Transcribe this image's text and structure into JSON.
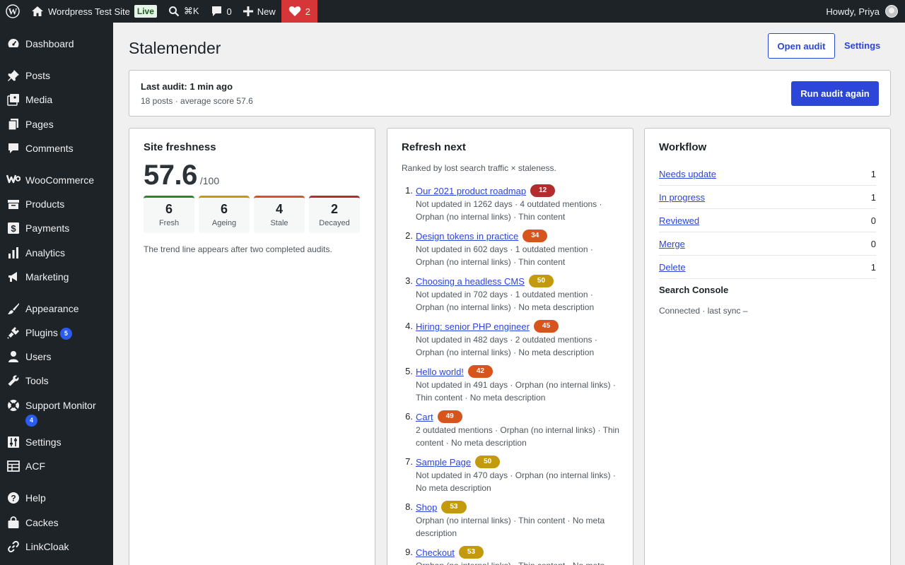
{
  "adminbar": {
    "site_name": "Wordpress Test Site",
    "live_badge": "Live",
    "search_shortcut": "⌘K",
    "comments_count": "0",
    "new_label": "New",
    "heart_count": "2",
    "greeting": "Howdy, Priya"
  },
  "sidebar": {
    "items": [
      {
        "label": "Dashboard",
        "icon": "dashboard-icon"
      },
      {
        "label": "Posts",
        "icon": "pin-icon"
      },
      {
        "label": "Media",
        "icon": "media-icon"
      },
      {
        "label": "Pages",
        "icon": "pages-icon"
      },
      {
        "label": "Comments",
        "icon": "comment-icon"
      },
      {
        "label": "WooCommerce",
        "icon": "woocommerce-icon"
      },
      {
        "label": "Products",
        "icon": "archive-icon"
      },
      {
        "label": "Payments",
        "icon": "dollar-icon"
      },
      {
        "label": "Analytics",
        "icon": "bar-chart-icon"
      },
      {
        "label": "Marketing",
        "icon": "megaphone-icon"
      },
      {
        "label": "Appearance",
        "icon": "brush-icon"
      },
      {
        "label": "Plugins",
        "icon": "plug-icon",
        "badge": "5"
      },
      {
        "label": "Users",
        "icon": "user-icon"
      },
      {
        "label": "Tools",
        "icon": "wrench-icon"
      },
      {
        "label": "Support Monitor",
        "icon": "lifebuoy-icon",
        "badge": "4"
      },
      {
        "label": "Settings",
        "icon": "sliders-icon"
      },
      {
        "label": "ACF",
        "icon": "table-icon"
      },
      {
        "label": "Help",
        "icon": "help-icon"
      },
      {
        "label": "Cackes",
        "icon": "bag-icon"
      },
      {
        "label": "LinkCloak",
        "icon": "link-icon"
      }
    ]
  },
  "header": {
    "title": "Stalemender",
    "open_audit": "Open audit",
    "settings": "Settings"
  },
  "audit": {
    "title": "Last audit: 1 min ago",
    "summary": "18 posts · average score 57.6",
    "run_again": "Run audit again"
  },
  "freshness": {
    "title": "Site freshness",
    "score": "57.6",
    "score_max": "/100",
    "stats": [
      {
        "value": "6",
        "label": "Fresh",
        "color": "#1f8a2c"
      },
      {
        "value": "6",
        "label": "Ageing",
        "color": "#c29a0b"
      },
      {
        "value": "4",
        "label": "Stale",
        "color": "#d8541d"
      },
      {
        "value": "2",
        "label": "Decayed",
        "color": "#b32d2e"
      }
    ],
    "note": "The trend line appears after two completed audits."
  },
  "refresh": {
    "title": "Refresh next",
    "subtitle": "Ranked by lost search traffic × staleness.",
    "items": [
      {
        "num": "1.",
        "title": "Our 2021 product roadmap",
        "score": "12",
        "color": "#b32d2e",
        "desc": "Not updated in 1262 days · 4 outdated mentions · Orphan (no internal links) · Thin content"
      },
      {
        "num": "2.",
        "title": "Design tokens in practice",
        "score": "34",
        "color": "#d8541d",
        "desc": "Not updated in 602 days · 1 outdated mention · Orphan (no internal links) · Thin content"
      },
      {
        "num": "3.",
        "title": "Choosing a headless CMS",
        "score": "50",
        "color": "#c29a0b",
        "desc": "Not updated in 702 days · 1 outdated mention · Orphan (no internal links) · No meta description"
      },
      {
        "num": "4.",
        "title": "Hiring: senior PHP engineer",
        "score": "45",
        "color": "#d8541d",
        "desc": "Not updated in 482 days · 2 outdated mentions · Orphan (no internal links) · No meta description"
      },
      {
        "num": "5.",
        "title": "Hello world!",
        "score": "42",
        "color": "#d8541d",
        "desc": "Not updated in 491 days · Orphan (no internal links) · Thin content · No meta description"
      },
      {
        "num": "6.",
        "title": "Cart",
        "score": "49",
        "color": "#d8541d",
        "desc": "2 outdated mentions · Orphan (no internal links) · Thin content · No meta description"
      },
      {
        "num": "7.",
        "title": "Sample Page",
        "score": "50",
        "color": "#c29a0b",
        "desc": "Not updated in 470 days · Orphan (no internal links) · No meta description"
      },
      {
        "num": "8.",
        "title": "Shop",
        "score": "53",
        "color": "#c29a0b",
        "desc": "Orphan (no internal links) · Thin content · No meta description"
      },
      {
        "num": "9.",
        "title": "Checkout",
        "score": "53",
        "color": "#c29a0b",
        "desc": "Orphan (no internal links) · Thin content · No meta description"
      }
    ]
  },
  "workflow": {
    "title": "Workflow",
    "rows": [
      {
        "label": "Needs update",
        "count": "1"
      },
      {
        "label": "In progress",
        "count": "1"
      },
      {
        "label": "Reviewed",
        "count": "0"
      },
      {
        "label": "Merge",
        "count": "0"
      },
      {
        "label": "Delete",
        "count": "1"
      }
    ],
    "search_console_title": "Search Console",
    "search_console_status": "Connected · last sync –"
  }
}
